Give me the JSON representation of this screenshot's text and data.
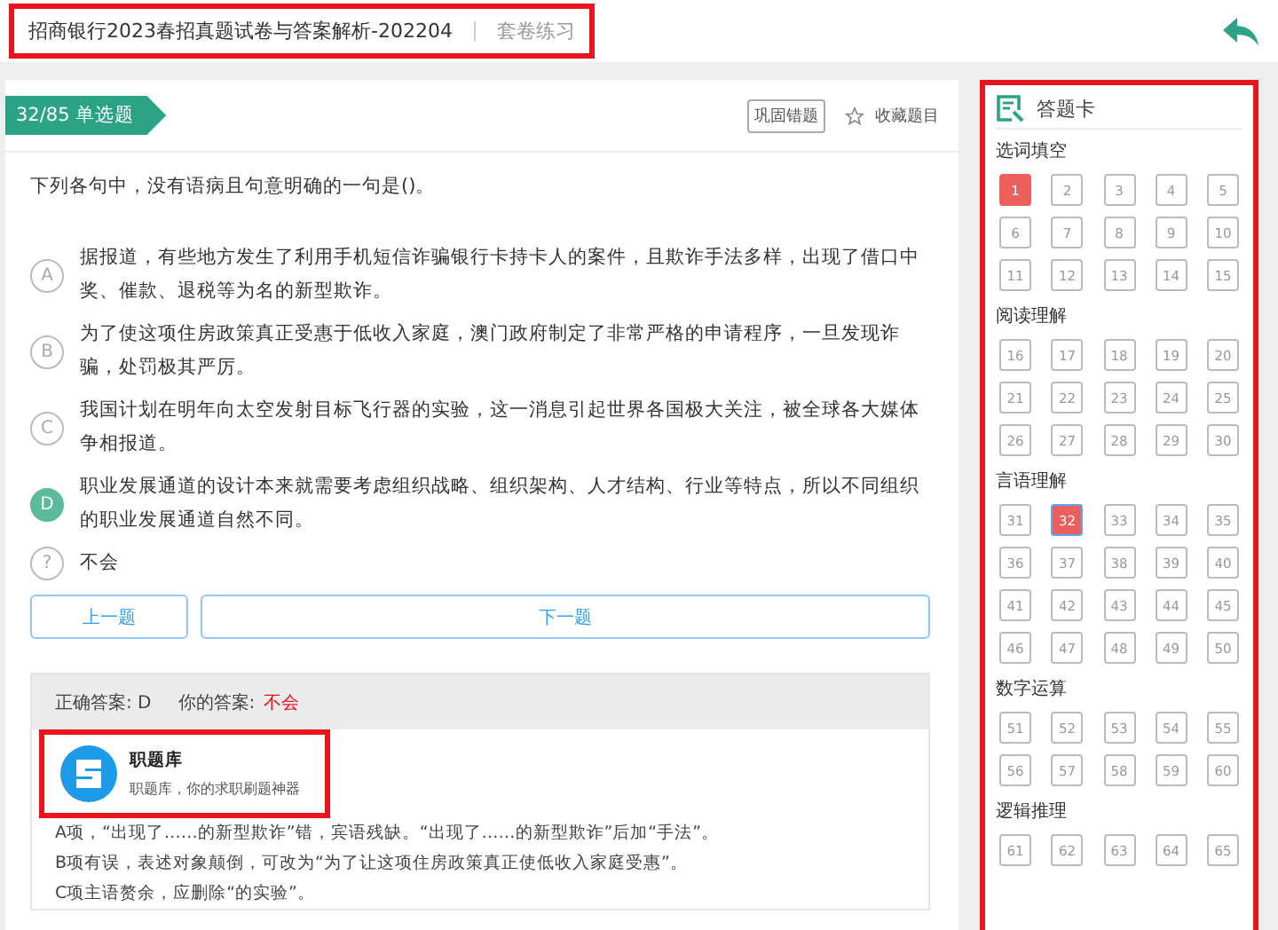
{
  "header": {
    "title": "招商银行2023春招真题试卷与答案解析-202204",
    "mode": "套卷练习"
  },
  "question": {
    "badge": "32/85 单选题",
    "actions": [
      "巩固错题",
      "收藏题目"
    ],
    "stem": "下列各句中，没有语病且句意明确的一句是()。",
    "options": [
      {
        "letter": "A",
        "text": "据报道，有些地方发生了利用手机短信诈骗银行卡持卡人的案件，且欺诈手法多样，出现了借口中奖、催款、退税等为名的新型欺诈。",
        "correct": false
      },
      {
        "letter": "B",
        "text": "为了使这项住房政策真正受惠于低收入家庭，澳门政府制定了非常严格的申请程序，一旦发现诈骗，处罚极其严厉。",
        "correct": false
      },
      {
        "letter": "C",
        "text": "我国计划在明年向太空发射目标飞行器的实验，这一消息引起世界各国极大关注，被全球各大媒体争相报道。",
        "correct": false
      },
      {
        "letter": "D",
        "text": "职业发展通道的设计本来就需要考虑组织战略、组织架构、人才结构、行业等特点，所以不同组织的职业发展通道自然不同。",
        "correct": true
      },
      {
        "letter": "?",
        "text": "不会",
        "correct": false
      }
    ],
    "prev": "上一题",
    "next": "下一题"
  },
  "answer": {
    "correct_label": "正确答案: D",
    "yours_label": "你的答案:",
    "yours": "不会",
    "brand": "职题库",
    "slogan": "职题库，你的求职刷题神器",
    "explanation": [
      "A项，“出现了……的新型欺诈”错，宾语残缺。“出现了……的新型欺诈”后加“手法”。",
      "B项有误，表述对象颠倒，可改为“为了让这项住房政策真正使低收入家庭受惠”。",
      "C项主语赘余，应删除“的实验”。"
    ]
  },
  "card": {
    "title": "答题卡",
    "sections": [
      {
        "name": "选词填空",
        "items": [
          {
            "n": "1",
            "wrong": true,
            "selected": false
          },
          {
            "n": "2",
            "wrong": false,
            "selected": false
          },
          {
            "n": "3",
            "wrong": false,
            "selected": false
          },
          {
            "n": "4",
            "wrong": false,
            "selected": false
          },
          {
            "n": "5",
            "wrong": false,
            "selected": false
          },
          {
            "n": "6",
            "wrong": false,
            "selected": false
          },
          {
            "n": "7",
            "wrong": false,
            "selected": false
          },
          {
            "n": "8",
            "wrong": false,
            "selected": false
          },
          {
            "n": "9",
            "wrong": false,
            "selected": false
          },
          {
            "n": "10",
            "wrong": false,
            "selected": false
          },
          {
            "n": "11",
            "wrong": false,
            "selected": false
          },
          {
            "n": "12",
            "wrong": false,
            "selected": false
          },
          {
            "n": "13",
            "wrong": false,
            "selected": false
          },
          {
            "n": "14",
            "wrong": false,
            "selected": false
          },
          {
            "n": "15",
            "wrong": false,
            "selected": false
          }
        ]
      },
      {
        "name": "阅读理解",
        "items": [
          {
            "n": "16",
            "wrong": false,
            "selected": false
          },
          {
            "n": "17",
            "wrong": false,
            "selected": false
          },
          {
            "n": "18",
            "wrong": false,
            "selected": false
          },
          {
            "n": "19",
            "wrong": false,
            "selected": false
          },
          {
            "n": "20",
            "wrong": false,
            "selected": false
          },
          {
            "n": "21",
            "wrong": false,
            "selected": false
          },
          {
            "n": "22",
            "wrong": false,
            "selected": false
          },
          {
            "n": "23",
            "wrong": false,
            "selected": false
          },
          {
            "n": "24",
            "wrong": false,
            "selected": false
          },
          {
            "n": "25",
            "wrong": false,
            "selected": false
          },
          {
            "n": "26",
            "wrong": false,
            "selected": false
          },
          {
            "n": "27",
            "wrong": false,
            "selected": false
          },
          {
            "n": "28",
            "wrong": false,
            "selected": false
          },
          {
            "n": "29",
            "wrong": false,
            "selected": false
          },
          {
            "n": "30",
            "wrong": false,
            "selected": false
          }
        ]
      },
      {
        "name": "言语理解",
        "items": [
          {
            "n": "31",
            "wrong": false,
            "selected": false
          },
          {
            "n": "32",
            "wrong": true,
            "selected": true
          },
          {
            "n": "33",
            "wrong": false,
            "selected": false
          },
          {
            "n": "34",
            "wrong": false,
            "selected": false
          },
          {
            "n": "35",
            "wrong": false,
            "selected": false
          },
          {
            "n": "36",
            "wrong": false,
            "selected": false
          },
          {
            "n": "37",
            "wrong": false,
            "selected": false
          },
          {
            "n": "38",
            "wrong": false,
            "selected": false
          },
          {
            "n": "39",
            "wrong": false,
            "selected": false
          },
          {
            "n": "40",
            "wrong": false,
            "selected": false
          },
          {
            "n": "41",
            "wrong": false,
            "selected": false
          },
          {
            "n": "42",
            "wrong": false,
            "selected": false
          },
          {
            "n": "43",
            "wrong": false,
            "selected": false
          },
          {
            "n": "44",
            "wrong": false,
            "selected": false
          },
          {
            "n": "45",
            "wrong": false,
            "selected": false
          },
          {
            "n": "46",
            "wrong": false,
            "selected": false
          },
          {
            "n": "47",
            "wrong": false,
            "selected": false
          },
          {
            "n": "48",
            "wrong": false,
            "selected": false
          },
          {
            "n": "49",
            "wrong": false,
            "selected": false
          },
          {
            "n": "50",
            "wrong": false,
            "selected": false
          }
        ]
      },
      {
        "name": "数字运算",
        "items": [
          {
            "n": "51",
            "wrong": false,
            "selected": false
          },
          {
            "n": "52",
            "wrong": false,
            "selected": false
          },
          {
            "n": "53",
            "wrong": false,
            "selected": false
          },
          {
            "n": "54",
            "wrong": false,
            "selected": false
          },
          {
            "n": "55",
            "wrong": false,
            "selected": false
          },
          {
            "n": "56",
            "wrong": false,
            "selected": false
          },
          {
            "n": "57",
            "wrong": false,
            "selected": false
          },
          {
            "n": "58",
            "wrong": false,
            "selected": false
          },
          {
            "n": "59",
            "wrong": false,
            "selected": false
          },
          {
            "n": "60",
            "wrong": false,
            "selected": false
          }
        ]
      },
      {
        "name": "逻辑推理",
        "items": [
          {
            "n": "61",
            "wrong": false,
            "selected": false
          },
          {
            "n": "62",
            "wrong": false,
            "selected": false
          },
          {
            "n": "63",
            "wrong": false,
            "selected": false
          },
          {
            "n": "64",
            "wrong": false,
            "selected": false
          },
          {
            "n": "65",
            "wrong": false,
            "selected": false
          }
        ]
      }
    ]
  }
}
